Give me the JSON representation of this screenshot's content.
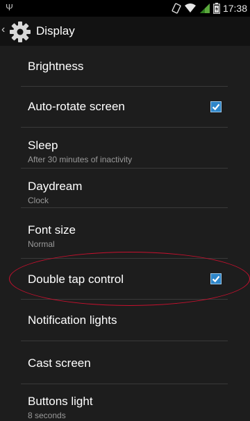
{
  "status": {
    "time": "17:38"
  },
  "header": {
    "title": "Display"
  },
  "settings": {
    "brightness": {
      "title": "Brightness"
    },
    "auto_rotate": {
      "title": "Auto-rotate screen",
      "checked": true
    },
    "sleep": {
      "title": "Sleep",
      "summary": "After 30 minutes of inactivity"
    },
    "daydream": {
      "title": "Daydream",
      "summary": "Clock"
    },
    "font_size": {
      "title": "Font size",
      "summary": "Normal"
    },
    "double_tap": {
      "title": "Double tap control",
      "checked": true
    },
    "notification_lights": {
      "title": "Notification lights"
    },
    "cast_screen": {
      "title": "Cast screen"
    },
    "buttons_light": {
      "title": "Buttons light",
      "summary": "8 seconds"
    }
  },
  "colors": {
    "accent": "#2e86c9",
    "annotation": "#c8102e"
  }
}
